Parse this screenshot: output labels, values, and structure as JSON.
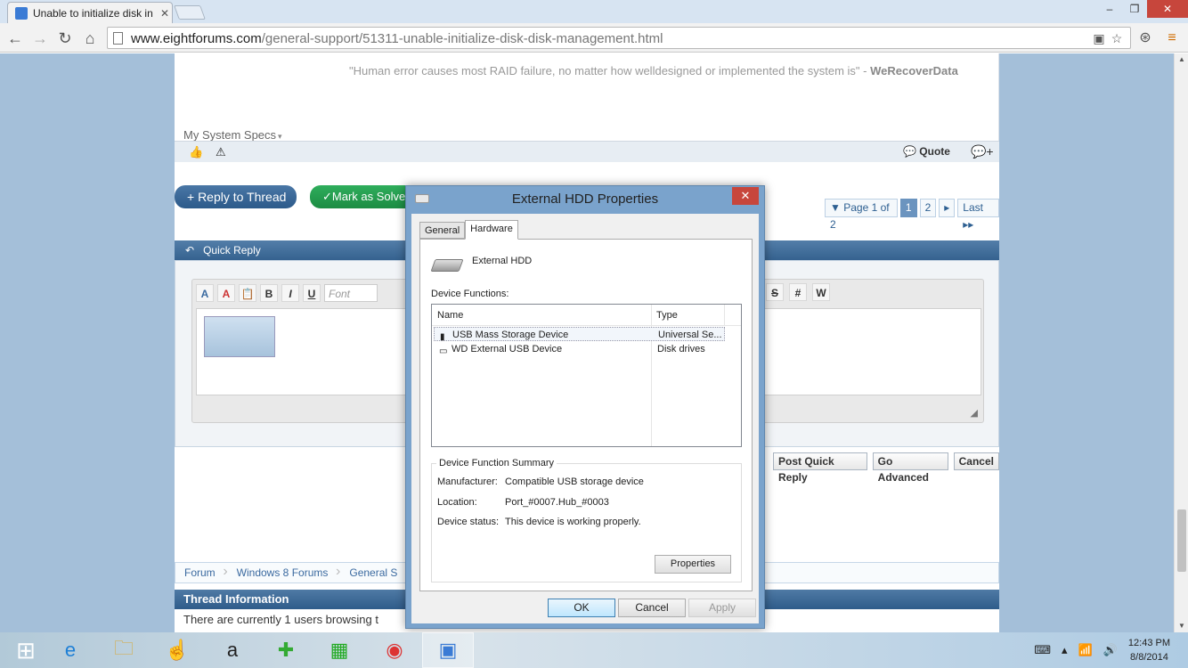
{
  "browser": {
    "tab_title": "Unable to initialize disk in",
    "tab_close": "✕",
    "url_domain": "www.eightforums.com",
    "url_path": "/general-support/51311-unable-initialize-disk-disk-management.html",
    "win_minimize": "–",
    "win_restore": "❐",
    "win_close": "✕"
  },
  "post": {
    "signature_quote": "\"Human error causes most RAID failure, no matter how welldesigned or implemented the system is\" - ",
    "signature_source": "WeRecoverData",
    "system_specs": "My System Specs",
    "quote_label": "Quote"
  },
  "actions": {
    "reply_to_thread": "+ Reply to Thread",
    "mark_as_solved": "✓Mark as Solved"
  },
  "pagination": {
    "page_of": "▼ Page 1 of 2",
    "pages": [
      "1",
      "2"
    ],
    "next": "▸",
    "last": "Last ▸▸"
  },
  "quick_reply": {
    "title": "Quick Reply",
    "font_placeholder": "Font",
    "buttons": [
      "Post Quick Reply",
      "Go Advanced",
      "Cancel"
    ]
  },
  "breadcrumb": [
    "Forum",
    "Windows 8 Forums",
    "General S"
  ],
  "thread_info": {
    "title": "Thread Information",
    "text": "There are currently 1 users browsing t"
  },
  "dialog": {
    "title": "External HDD Properties",
    "close": "✕",
    "tabs": [
      "General",
      "Hardware"
    ],
    "active_tab": "Hardware",
    "device_name": "External HDD",
    "device_functions_label": "Device Functions:",
    "columns": [
      "Name",
      "Type"
    ],
    "rows": [
      {
        "name": "USB Mass Storage Device",
        "type": "Universal Se..."
      },
      {
        "name": "WD  External USB Device",
        "type": "Disk drives"
      }
    ],
    "summary_title": "Device Function Summary",
    "summary": [
      {
        "label": "Manufacturer:",
        "value": "Compatible USB storage device"
      },
      {
        "label": "Location:",
        "value": "Port_#0007.Hub_#0003"
      },
      {
        "label": "Device status:",
        "value": "This device is working properly."
      }
    ],
    "properties_button": "Properties",
    "ok_button": "OK",
    "cancel_button": "Cancel",
    "apply_button": "Apply"
  },
  "taskbar": {
    "time": "12:43 PM",
    "date": "8/8/2014"
  }
}
